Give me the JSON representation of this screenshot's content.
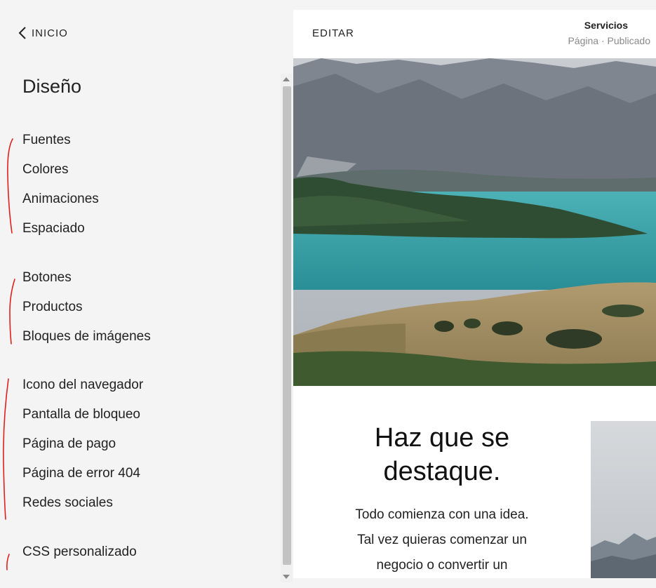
{
  "panel": {
    "back_label": "INICIO",
    "title": "Diseño",
    "items": [
      "Fuentes",
      "Colores",
      "Animaciones",
      "Espaciado",
      "Botones",
      "Productos",
      "Bloques de imágenes",
      "Icono del navegador",
      "Pantalla de bloqueo",
      "Página de pago",
      "Página de error 404",
      "Redes sociales",
      "CSS personalizado"
    ]
  },
  "preview": {
    "edit_label": "EDITAR",
    "page_name": "Servicios",
    "page_status": "Página · Publicado",
    "headline_line1": "Haz que se",
    "headline_line2": "destaque.",
    "body_line1": "Todo comienza con una idea.",
    "body_line2": "Tal vez quieras comenzar un",
    "body_line3": "negocio o convertir un"
  },
  "colors": {
    "panel_bg": "#f4f4f4",
    "annotation": "#e0201c",
    "lake": "#2f9aa0"
  }
}
